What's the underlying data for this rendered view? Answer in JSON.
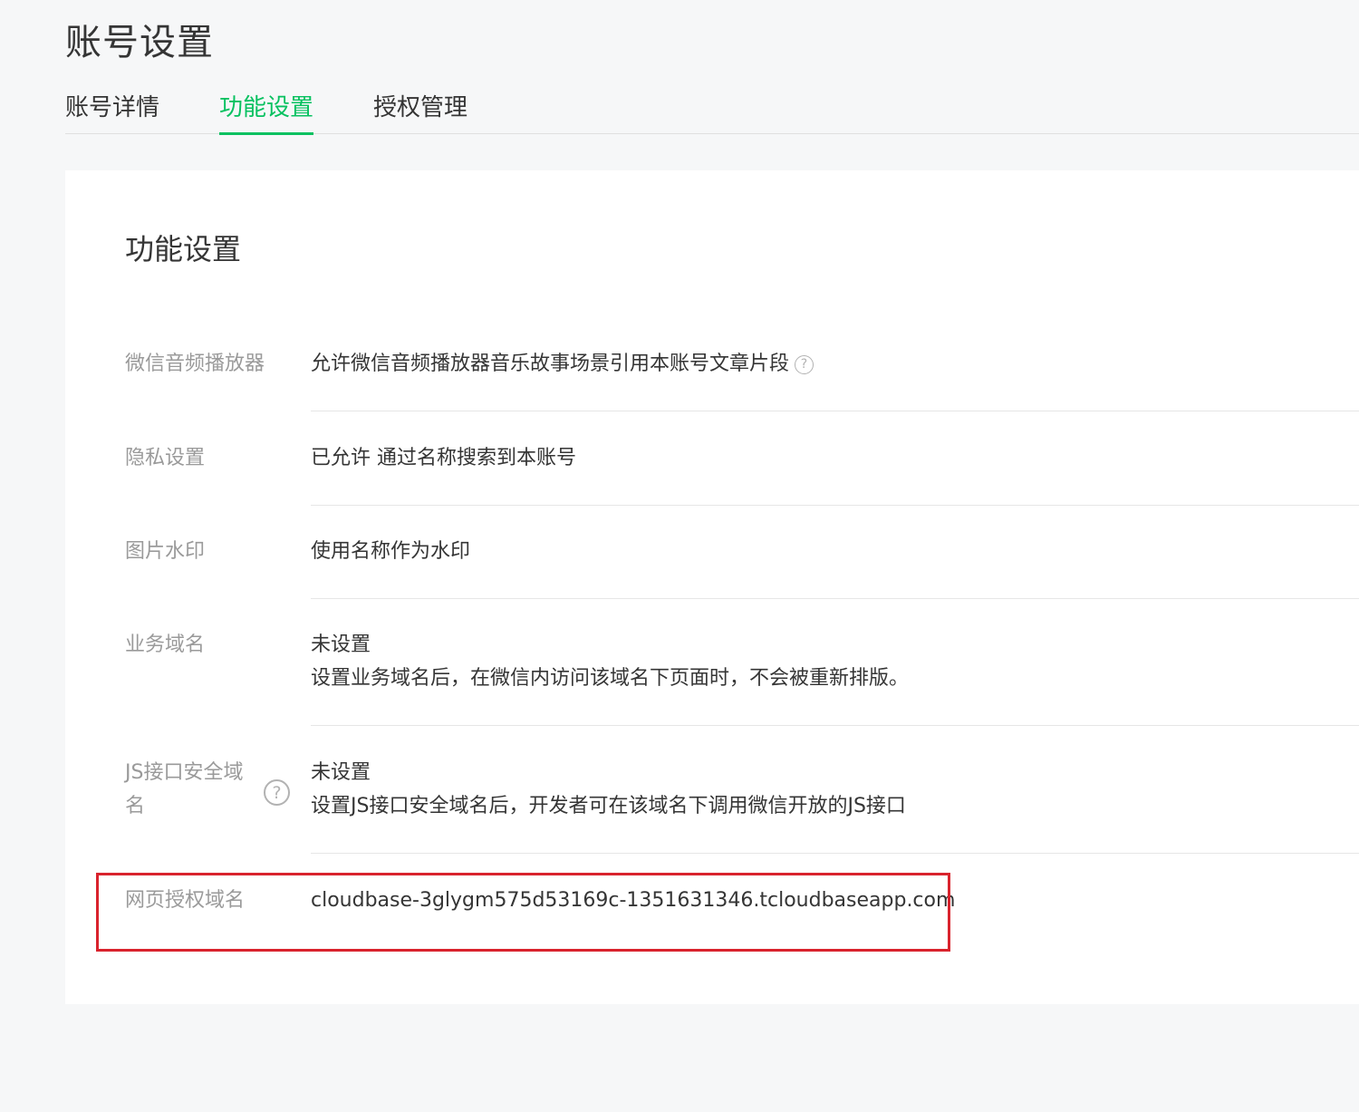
{
  "page_title": "账号设置",
  "tabs": [
    {
      "label": "账号详情",
      "active": false
    },
    {
      "label": "功能设置",
      "active": true
    },
    {
      "label": "授权管理",
      "active": false
    }
  ],
  "section_title": "功能设置",
  "rows": [
    {
      "label": "微信音频播放器",
      "value": "允许微信音频播放器音乐故事场景引用本账号文章片段",
      "help": "?"
    },
    {
      "label": "隐私设置",
      "value": "已允许 通过名称搜索到本账号"
    },
    {
      "label": "图片水印",
      "value": "使用名称作为水印"
    },
    {
      "label": "业务域名",
      "value": "未设置",
      "desc": "设置业务域名后，在微信内访问该域名下页面时，不会被重新排版。"
    },
    {
      "label_line1": "JS接口安全域",
      "label_line2": "名",
      "help": "?",
      "value": "未设置",
      "desc": "设置JS接口安全域名后，开发者可在该域名下调用微信开放的JS接口"
    },
    {
      "label": "网页授权域名",
      "value": "cloudbase-3glygm575d53169c-1351631346.tcloudbaseapp.com"
    }
  ],
  "colors": {
    "accent": "#07c160",
    "highlight": "#d9232d",
    "label": "#9a9a9a",
    "text": "#353535",
    "background": "#f6f7f8"
  }
}
